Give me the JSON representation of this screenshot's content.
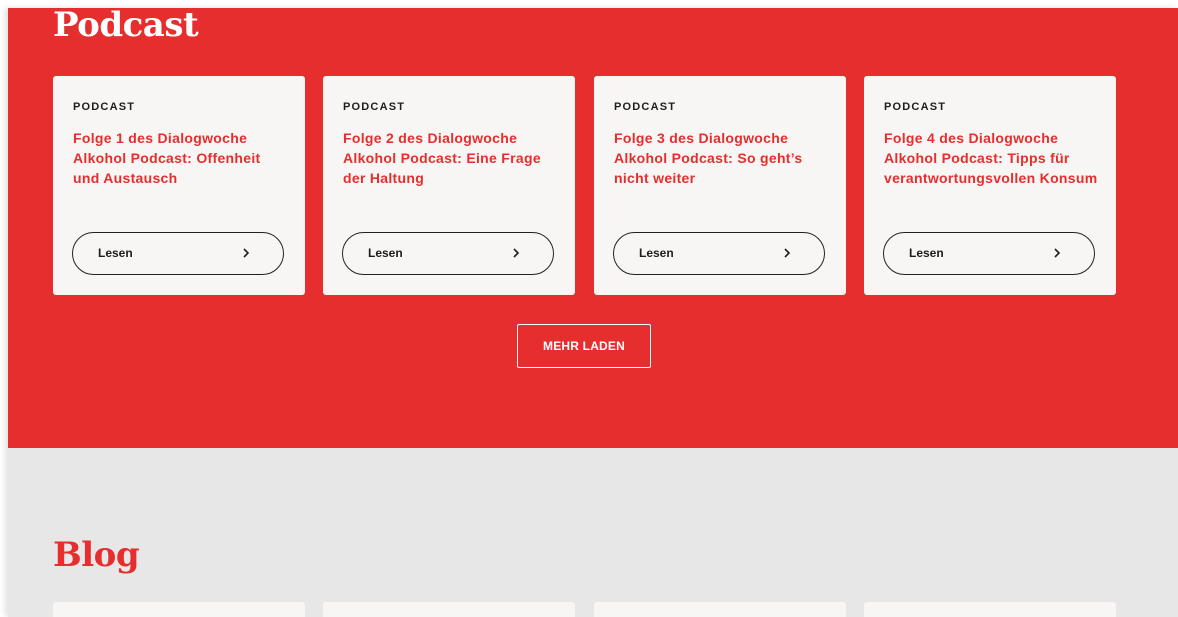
{
  "podcast": {
    "title": "Podcast",
    "cards": [
      {
        "kicker": "PODCAST",
        "heading": "Folge 1 des Dialogwoche Alkohol Podcast: Offenheit und Austausch",
        "button": "Lesen"
      },
      {
        "kicker": "PODCAST",
        "heading": "Folge 2 des Dialogwoche Alkohol Podcast: Eine Frage der Haltung",
        "button": "Lesen"
      },
      {
        "kicker": "PODCAST",
        "heading": "Folge 3 des Dialogwoche Alkohol Podcast: So geht’s nicht weiter",
        "button": "Lesen"
      },
      {
        "kicker": "PODCAST",
        "heading": "Folge 4 des Dialogwoche Alkohol Podcast: Tipps für verantwortungsvollen Konsum",
        "button": "Lesen"
      }
    ],
    "more_button": "MEHR LADEN"
  },
  "blog": {
    "title": "Blog"
  },
  "icons": {
    "read_chevron": "chevron-right-icon"
  },
  "colors": {
    "brand_red": "#e62e2e",
    "card_bg": "#f7f6f4",
    "blog_bg": "#e7e7e7"
  }
}
